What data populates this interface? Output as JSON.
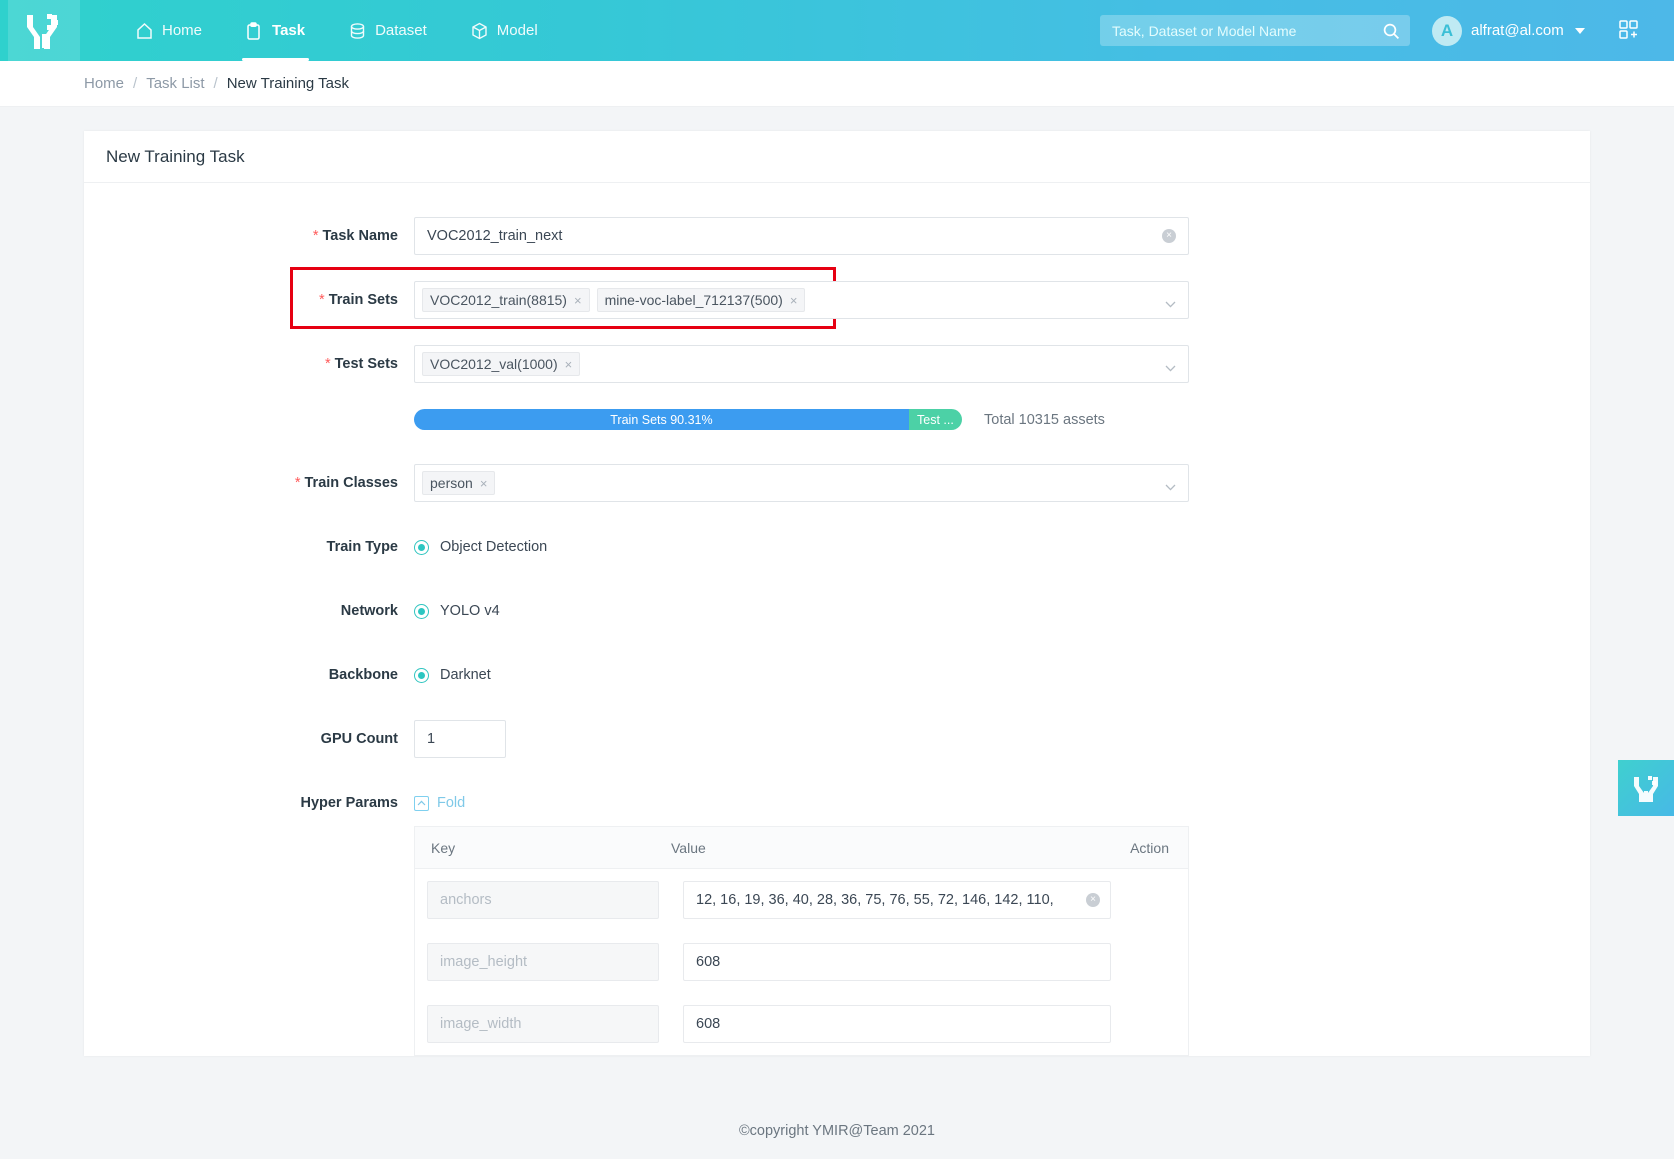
{
  "header": {
    "logo_icon": "ymir-logo-icon",
    "nav": [
      {
        "label": "Home",
        "icon": "home-icon",
        "active": false
      },
      {
        "label": "Task",
        "icon": "clipboard-icon",
        "active": true
      },
      {
        "label": "Dataset",
        "icon": "database-icon",
        "active": false
      },
      {
        "label": "Model",
        "icon": "cube-icon",
        "active": false
      }
    ],
    "search": {
      "placeholder": "Task, Dataset or Model Name",
      "value": "",
      "icon": "search-icon"
    },
    "user": {
      "avatar_letter": "A",
      "email": "alfrat@al.com",
      "caret_icon": "chevron-down-icon"
    },
    "right_icon": "app-switcher-icon"
  },
  "breadcrumb": {
    "items": [
      "Home",
      "Task List",
      "New Training Task"
    ],
    "separator": "/"
  },
  "card": {
    "title": "New Training Task"
  },
  "form": {
    "task_name": {
      "label": "Task Name",
      "required_mark": "*",
      "value": "VOC2012_train_next",
      "clear_icon": "clear-circle-icon"
    },
    "train_sets": {
      "label": "Train Sets",
      "required_mark": "*",
      "tags": [
        "VOC2012_train(8815)",
        "mine-voc-label_712137(500)"
      ],
      "tag_remove_icon": "close-icon",
      "dropdown_icon": "chevron-down-icon",
      "highlight_color": "#e60012"
    },
    "test_sets": {
      "label": "Test Sets",
      "required_mark": "*",
      "tags": [
        "VOC2012_val(1000)"
      ],
      "tag_remove_icon": "close-icon",
      "dropdown_icon": "chevron-down-icon"
    },
    "split": {
      "train_label": "Train Sets 90.31%",
      "train_percent": 90.31,
      "train_color": "#3c9cf0",
      "test_label": "Test ...",
      "test_percent": 9.69,
      "test_color": "#4cd1a6",
      "total_text": "Total 10315 assets"
    },
    "train_classes": {
      "label": "Train Classes",
      "required_mark": "*",
      "tags": [
        "person"
      ],
      "tag_remove_icon": "close-icon",
      "dropdown_icon": "chevron-down-icon"
    },
    "train_type": {
      "label": "Train Type",
      "selected": "Object Detection",
      "options": [
        "Object Detection"
      ]
    },
    "network": {
      "label": "Network",
      "selected": "YOLO v4",
      "options": [
        "YOLO v4"
      ]
    },
    "backbone": {
      "label": "Backbone",
      "selected": "Darknet",
      "options": [
        "Darknet"
      ]
    },
    "gpu_count": {
      "label": "GPU Count",
      "value": "1"
    },
    "hyper_params": {
      "label": "Hyper Params",
      "fold_label": "Fold",
      "fold_icon": "chevron-up-icon",
      "columns": [
        "Key",
        "Value",
        "Action"
      ],
      "rows": [
        {
          "key": "anchors",
          "value": "12, 16, 19, 36, 40, 28, 36, 75, 76, 55, 72, 146, 142, 110,",
          "clear_icon": "clear-circle-icon",
          "has_clear": true
        },
        {
          "key": "image_height",
          "value": "608",
          "has_clear": false
        },
        {
          "key": "image_width",
          "value": "608",
          "has_clear": false
        }
      ]
    }
  },
  "footer": {
    "text": "©copyright YMIR@Team 2021"
  },
  "float_widget": {
    "icon": "ymir-float-icon"
  }
}
